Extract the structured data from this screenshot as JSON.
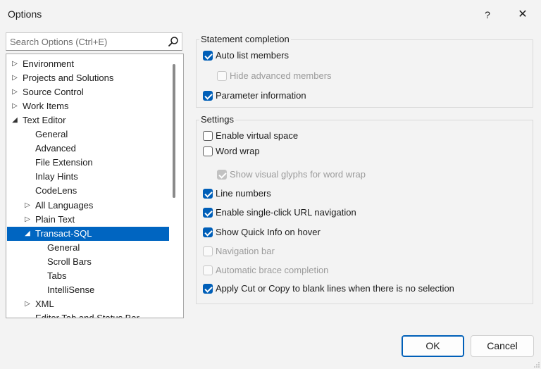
{
  "window": {
    "title": "Options",
    "help": "?",
    "close": "✕"
  },
  "search": {
    "placeholder": "Search Options (Ctrl+E)"
  },
  "tree": [
    {
      "label": "Environment",
      "expander": "▷",
      "level": 0
    },
    {
      "label": "Projects and Solutions",
      "expander": "▷",
      "level": 0
    },
    {
      "label": "Source Control",
      "expander": "▷",
      "level": 0
    },
    {
      "label": "Work Items",
      "expander": "▷",
      "level": 0
    },
    {
      "label": "Text Editor",
      "expander": "◢",
      "level": 0
    },
    {
      "label": "General",
      "expander": "",
      "level": 1
    },
    {
      "label": "Advanced",
      "expander": "",
      "level": 1
    },
    {
      "label": "File Extension",
      "expander": "",
      "level": 1
    },
    {
      "label": "Inlay Hints",
      "expander": "",
      "level": 1
    },
    {
      "label": "CodeLens",
      "expander": "",
      "level": 1
    },
    {
      "label": "All Languages",
      "expander": "▷",
      "level": 1
    },
    {
      "label": "Plain Text",
      "expander": "▷",
      "level": 1
    },
    {
      "label": "Transact-SQL",
      "expander": "◢",
      "level": 1,
      "selected": true
    },
    {
      "label": "General",
      "expander": "",
      "level": 2
    },
    {
      "label": "Scroll Bars",
      "expander": "",
      "level": 2
    },
    {
      "label": "Tabs",
      "expander": "",
      "level": 2
    },
    {
      "label": "IntelliSense",
      "expander": "",
      "level": 2
    },
    {
      "label": "XML",
      "expander": "▷",
      "level": 1
    },
    {
      "label": "Editor Tab and Status Bar",
      "expander": "",
      "level": 1
    }
  ],
  "statement_completion": {
    "title": "Statement completion",
    "auto_list": {
      "label": "Auto list members",
      "checked": true,
      "enabled": true
    },
    "hide_advanced": {
      "label": "Hide advanced members",
      "checked": false,
      "enabled": false
    },
    "param_info": {
      "label": "Parameter information",
      "checked": true,
      "enabled": true
    }
  },
  "settings": {
    "title": "Settings",
    "virtual_space": {
      "label": "Enable virtual space",
      "checked": false,
      "enabled": true
    },
    "word_wrap": {
      "label": "Word wrap",
      "checked": false,
      "enabled": true
    },
    "visual_glyphs": {
      "label": "Show visual glyphs for word wrap",
      "checked": true,
      "enabled": false
    },
    "line_numbers": {
      "label": "Line numbers",
      "checked": true,
      "enabled": true
    },
    "url_nav": {
      "label": "Enable single-click URL navigation",
      "checked": true,
      "enabled": true
    },
    "quick_info": {
      "label": "Show Quick Info on hover",
      "checked": true,
      "enabled": true
    },
    "nav_bar": {
      "label": "Navigation bar",
      "checked": false,
      "enabled": false
    },
    "brace": {
      "label": "Automatic brace completion",
      "checked": false,
      "enabled": false
    },
    "cut_copy": {
      "label": "Apply Cut or Copy to blank lines when there is no selection",
      "checked": true,
      "enabled": true
    }
  },
  "buttons": {
    "ok": "OK",
    "cancel": "Cancel"
  },
  "colors": {
    "accent": "#005fb8",
    "selection": "#0065c1"
  },
  "icons": {
    "search": "search-icon",
    "close": "close-icon"
  }
}
